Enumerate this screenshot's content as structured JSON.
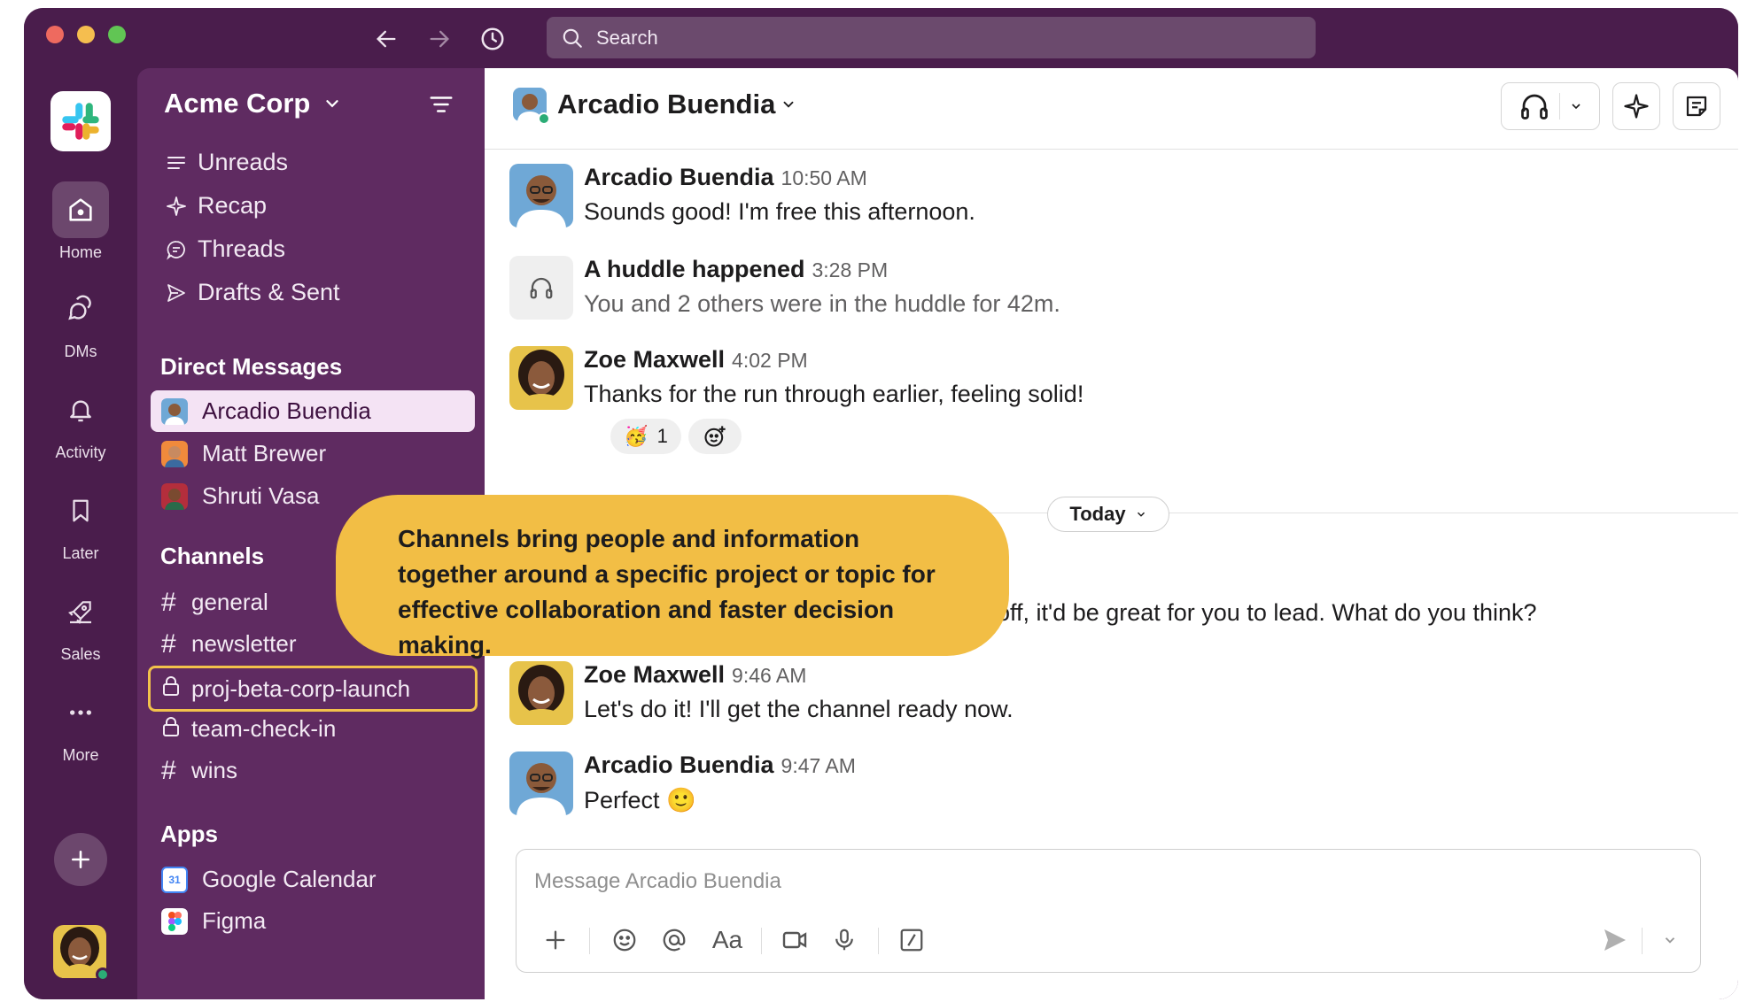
{
  "search": {
    "placeholder": "Search"
  },
  "rail": {
    "items": [
      {
        "label": "Home"
      },
      {
        "label": "DMs"
      },
      {
        "label": "Activity"
      },
      {
        "label": "Later"
      },
      {
        "label": "Sales"
      },
      {
        "label": "More"
      }
    ]
  },
  "sidebar": {
    "workspace": "Acme Corp",
    "nav": [
      {
        "label": "Unreads"
      },
      {
        "label": "Recap"
      },
      {
        "label": "Threads"
      },
      {
        "label": "Drafts & Sent"
      }
    ],
    "dm_header": "Direct Messages",
    "dms": [
      {
        "label": "Arcadio Buendia"
      },
      {
        "label": "Matt Brewer"
      },
      {
        "label": "Shruti Vasa"
      }
    ],
    "channels_header": "Channels",
    "channels": [
      {
        "label": "general",
        "private": false
      },
      {
        "label": "newsletter",
        "private": false
      },
      {
        "label": "proj-beta-corp-launch",
        "private": true
      },
      {
        "label": "team-check-in",
        "private": true
      },
      {
        "label": "wins",
        "private": false
      }
    ],
    "apps_header": "Apps",
    "apps": [
      {
        "label": "Google Calendar",
        "icon_text": "31"
      },
      {
        "label": "Figma"
      }
    ]
  },
  "chat": {
    "title": "Arcadio Buendia",
    "messages": [
      {
        "author": "Arcadio Buendia",
        "time": "10:50 AM",
        "text": "Sounds good! I'm free this afternoon."
      },
      {
        "author": "A huddle happened",
        "time": "3:28 PM",
        "text": "You and 2 others were in the huddle for 42m."
      },
      {
        "author": "Zoe Maxwell",
        "time": "4:02 PM",
        "text": "Thanks for the run through earlier, feeling solid!"
      },
      {
        "author": "",
        "time": "",
        "text": "off, it'd be great for you to lead. What do you think?"
      },
      {
        "author": "Zoe Maxwell",
        "time": "9:46 AM",
        "text": "Let's do it! I'll get the channel ready now."
      },
      {
        "author": "Arcadio Buendia",
        "time": "9:47 AM",
        "text": "Perfect"
      }
    ],
    "reaction_count": "1",
    "reaction_emoji": "🥳",
    "emoji_perfect": "🙂",
    "divider_label": "Today"
  },
  "composer": {
    "placeholder": "Message Arcadio Buendia",
    "format_label": "Aa"
  },
  "tooltip": {
    "text": "Channels bring people and information together around a specific project or topic for effective collaboration and faster decision making."
  },
  "colors": {
    "aubergine": "#4a1d4c",
    "sidebar": "#5f2b61",
    "tooltip": "#f2be45",
    "online": "#2bac76"
  }
}
